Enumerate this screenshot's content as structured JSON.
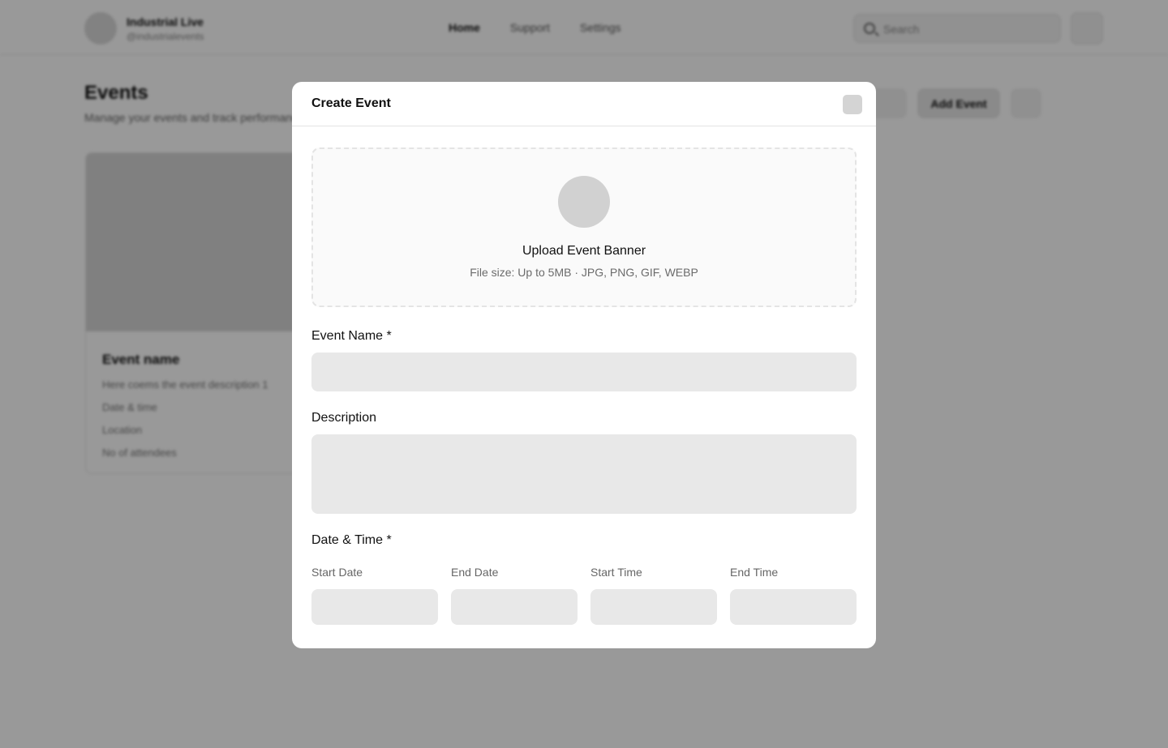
{
  "header": {
    "brand_name": "Industrial Live",
    "brand_handle": "@industrialevents",
    "nav": [
      "Home",
      "Support",
      "Settings"
    ],
    "search_placeholder": "Search"
  },
  "page": {
    "title": "Events",
    "subtitle": "Manage your events and track performance",
    "add_event_label": "Add Event"
  },
  "event_card": {
    "title": "Event name",
    "description": "Here coems the event description 1",
    "date_time": "Date & time",
    "location": "Location",
    "attendees": "No of attendees"
  },
  "modal": {
    "title": "Create Event",
    "upload": {
      "title": "Upload Event Banner",
      "subtitle": "File size: Up to 5MB · JPG, PNG, GIF, WEBP"
    },
    "event_name_label": "Event Name *",
    "description_label": "Description",
    "date_time_label": "Date & Time *",
    "start_date_label": "Start Date",
    "end_date_label": "End Date",
    "start_time_label": "Start Time",
    "end_time_label": "End Time"
  }
}
